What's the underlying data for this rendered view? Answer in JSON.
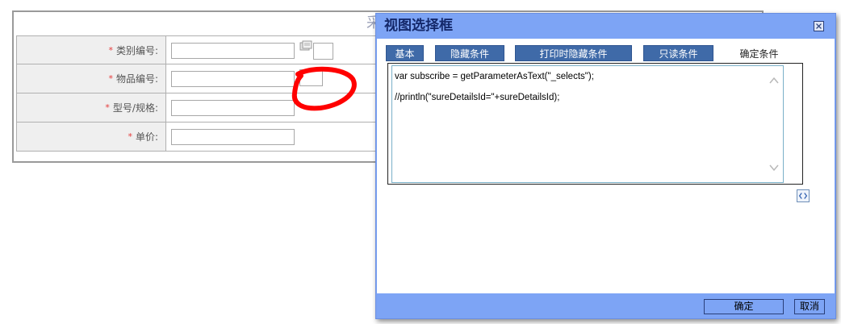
{
  "background_form": {
    "title": "采",
    "rows": [
      {
        "label": "类别编号:",
        "required_mark": "*"
      },
      {
        "label": "物品编号:",
        "required_mark": "*"
      },
      {
        "label": "型号/规格:",
        "required_mark": "*"
      },
      {
        "label": "单价:",
        "required_mark": "*"
      }
    ]
  },
  "dialog": {
    "title": "视图选择框",
    "tabs": [
      {
        "label": "基本"
      },
      {
        "label": "隐藏条件"
      },
      {
        "label": "打印时隐藏条件"
      },
      {
        "label": "只读条件"
      },
      {
        "label": "确定条件",
        "active": true
      }
    ],
    "code_lines": [
      "var subscribe = getParameterAsText(\"_selects\");",
      "//println(\"sureDetailsId=\"+sureDetailsId);"
    ],
    "footer": {
      "ok_label": "确定",
      "cancel_label": "取消"
    }
  },
  "colors": {
    "dialog_chrome": "#7da4f5",
    "tab_inactive": "#3f6aa8",
    "title_text": "#14286a",
    "required": "#e53b3b",
    "annotation": "#ff0000"
  }
}
